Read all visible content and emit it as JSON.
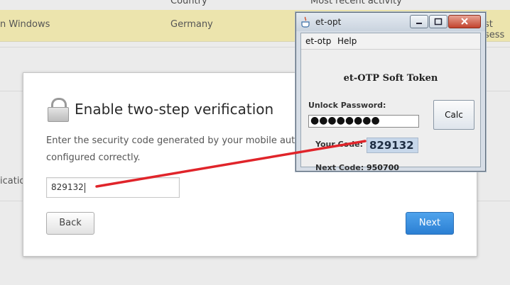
{
  "background": {
    "col_country": "Country",
    "col_activity": "Most recent activity",
    "row_device": "n Windows",
    "row_country": "Germany",
    "row_activity": "st sess",
    "side_label": "ication"
  },
  "modal": {
    "title": "Enable two-step verification",
    "description": "Enter the security code generated by your mobile authent configured correctly.",
    "description_line1": "Enter the security code generated by your mobile authent",
    "description_line2": "configured correctly.",
    "code_value": "829132",
    "back_label": "Back",
    "next_label": "Next",
    "icon": "lock-icon"
  },
  "otp_window": {
    "title": "et-opt",
    "menu": [
      "et-otp",
      "Help"
    ],
    "heading": "et-OTP Soft Token",
    "unlock_label": "Unlock Password:",
    "password_masked": "●●●●●●●●",
    "calc_label": "Calc",
    "your_code_label": "Your Code:",
    "your_code_value": "829132",
    "next_code_label": "Next Code:",
    "next_code_value": "950700",
    "icon": "java-icon"
  },
  "colors": {
    "accent": "#2b7fd3",
    "highlight_row": "#ece4ad",
    "annotation": "#e0242a",
    "code_highlight": "#c7d7ea"
  }
}
